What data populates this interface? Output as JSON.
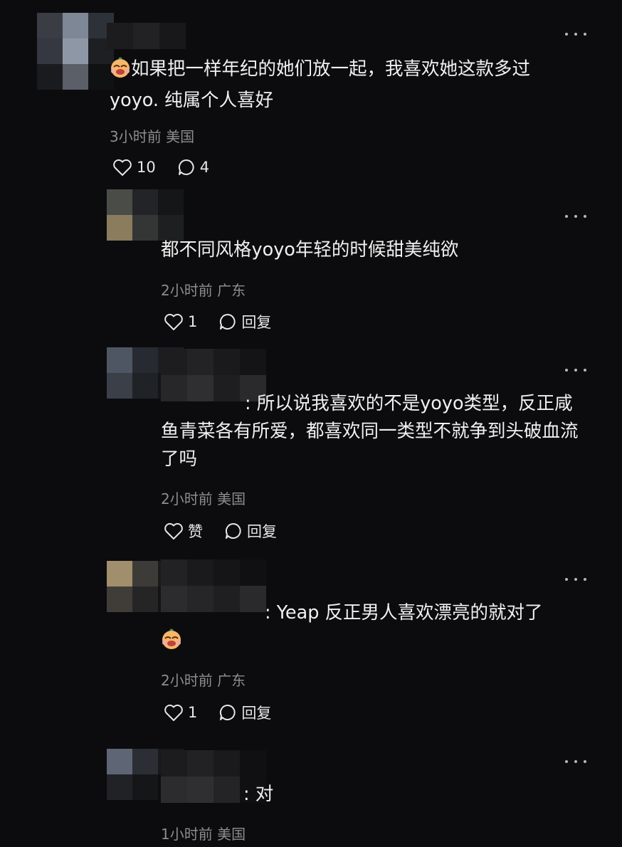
{
  "comments": [
    {
      "text": "如果把一样年纪的她们放一起，我喜欢她这款多过yoyo. 纯属个人喜好",
      "time": "3小时前",
      "location": "美国",
      "likes": "10",
      "replies": "4",
      "emoji": "crying-laughing-emoji"
    },
    {
      "text": "都不同风格yoyo年轻的时候甜美纯欲",
      "time": "2小时前",
      "location": "广东",
      "likes": "1",
      "reply_label": "回复"
    },
    {
      "text": ": 所以说我喜欢的不是yoyo类型，反正咸鱼青菜各有所爱，都喜欢同一类型不就争到头破血流了吗",
      "time": "2小时前",
      "location": "美国",
      "likes": "赞",
      "reply_label": "回复"
    },
    {
      "text": ": Yeap 反正男人喜欢漂亮的就对了",
      "time": "2小时前",
      "location": "广东",
      "likes": "1",
      "reply_label": "回复",
      "emoji": "crying-laughing-emoji"
    },
    {
      "text": ": 对",
      "time": "1小时前",
      "location": "美国"
    }
  ],
  "colors": {
    "background": "#0c0c0e",
    "text": "#f0f0f0",
    "meta": "#8d8d8d"
  }
}
